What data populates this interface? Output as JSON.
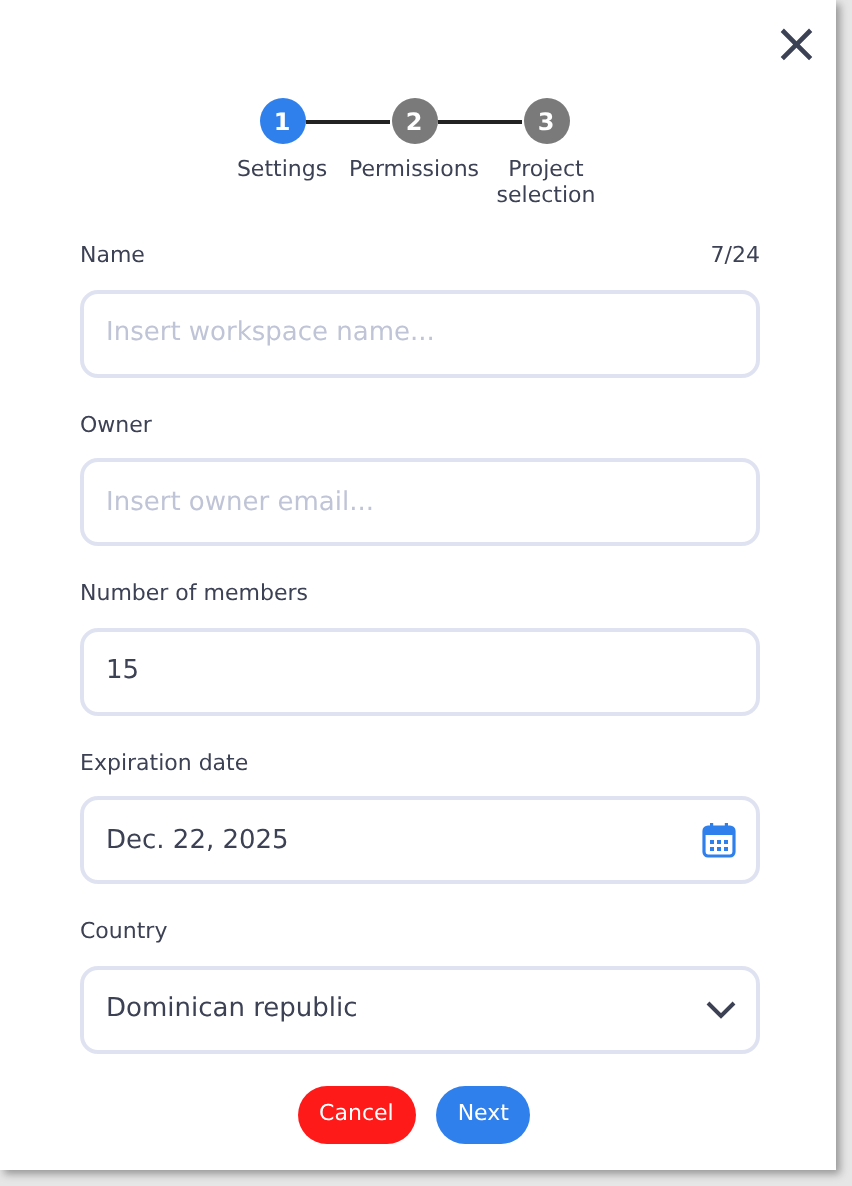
{
  "close": "×",
  "steps": [
    {
      "number": "1",
      "label": "Settings",
      "selected": true
    },
    {
      "number": "2",
      "label": "Permissions",
      "selected": false
    },
    {
      "number": "3",
      "label": "Project selection",
      "selected": false
    }
  ],
  "fields": [
    {
      "kind": "text",
      "label": "Name",
      "counter": "7/24",
      "placeholder": "Insert workspace name..."
    },
    {
      "kind": "text",
      "label": "Owner",
      "placeholder": "Insert owner email..."
    },
    {
      "kind": "text",
      "label": "Number of members",
      "value": "15"
    },
    {
      "kind": "date",
      "label": "Expiration date",
      "value": "Dec. 22, 2025"
    },
    {
      "kind": "select",
      "label": "Country",
      "value": "Dominican republic"
    }
  ],
  "buttons": [
    {
      "kind": "cancel",
      "label": "Cancel"
    },
    {
      "kind": "next",
      "label": "Next"
    }
  ]
}
